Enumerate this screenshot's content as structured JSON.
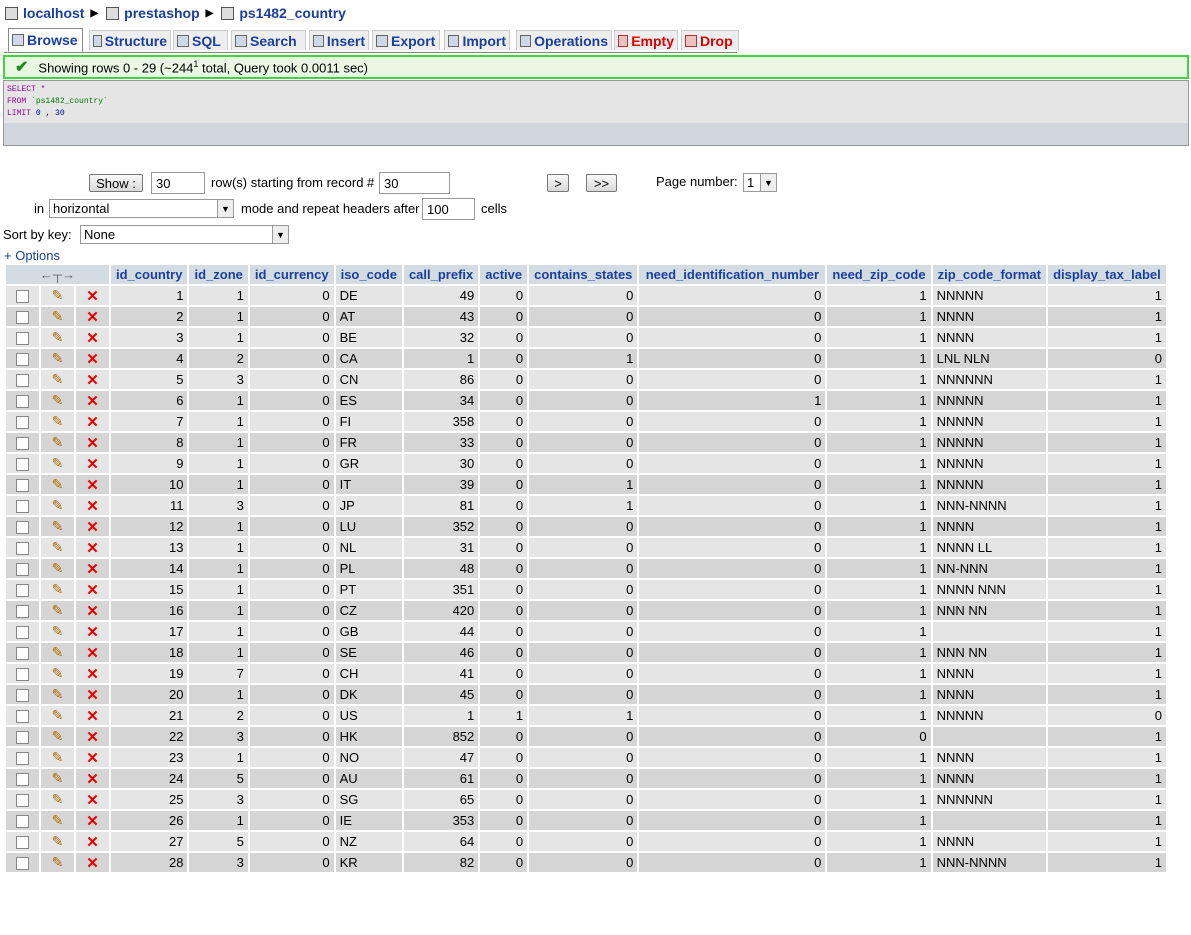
{
  "breadcrumb": {
    "server": "localhost",
    "database": "prestashop",
    "table": "ps1482_country"
  },
  "tabs": [
    {
      "label": "Browse",
      "icon": "browse-icon",
      "active": true,
      "red": false
    },
    {
      "label": "Structure",
      "icon": "structure-icon",
      "active": false,
      "red": false
    },
    {
      "label": "SQL",
      "icon": "sql-icon",
      "active": false,
      "red": false
    },
    {
      "label": "Search",
      "icon": "search-icon",
      "active": false,
      "red": false
    },
    {
      "label": "Insert",
      "icon": "insert-icon",
      "active": false,
      "red": false
    },
    {
      "label": "Export",
      "icon": "export-icon",
      "active": false,
      "red": false
    },
    {
      "label": "Import",
      "icon": "import-icon",
      "active": false,
      "red": false
    },
    {
      "label": "Operations",
      "icon": "operations-icon",
      "active": false,
      "red": false
    },
    {
      "label": "Empty",
      "icon": "empty-icon",
      "active": false,
      "red": true
    },
    {
      "label": "Drop",
      "icon": "drop-icon",
      "active": false,
      "red": true
    }
  ],
  "notice": {
    "text_before": "Showing rows 0 - 29 (~244",
    "superscript": "1",
    "text_after": " total, Query took 0.0011 sec)"
  },
  "sql": {
    "line1_kw": "SELECT",
    "line1_rest": " *",
    "line2_kw": "FROM",
    "line2_table": "`ps1482_country`",
    "line3_kw": "LIMIT",
    "line3_start": "0",
    "line3_sep": " , ",
    "line3_count": "30"
  },
  "navigation": {
    "show_label": "Show :",
    "rows_value": "30",
    "rows_text": "row(s) starting from record #",
    "start_value": "30",
    "next_label": ">",
    "last_label": ">>",
    "page_label": "Page number:",
    "page_value": "1",
    "in_label": "in",
    "mode_value": "horizontal",
    "repeat_text": "mode and repeat headers after",
    "repeat_value": "100",
    "cells_text": "cells"
  },
  "sort": {
    "label": "Sort by key:",
    "value": "None"
  },
  "options_link": "+ Options",
  "columns": [
    "id_country",
    "id_zone",
    "id_currency",
    "iso_code",
    "call_prefix",
    "active",
    "contains_states",
    "need_identification_number",
    "need_zip_code",
    "zip_code_format",
    "display_tax_label"
  ],
  "rows": [
    [
      "1",
      "1",
      "0",
      "DE",
      "49",
      "0",
      "0",
      "0",
      "1",
      "NNNNN",
      "1"
    ],
    [
      "2",
      "1",
      "0",
      "AT",
      "43",
      "0",
      "0",
      "0",
      "1",
      "NNNN",
      "1"
    ],
    [
      "3",
      "1",
      "0",
      "BE",
      "32",
      "0",
      "0",
      "0",
      "1",
      "NNNN",
      "1"
    ],
    [
      "4",
      "2",
      "0",
      "CA",
      "1",
      "0",
      "1",
      "0",
      "1",
      "LNL NLN",
      "0"
    ],
    [
      "5",
      "3",
      "0",
      "CN",
      "86",
      "0",
      "0",
      "0",
      "1",
      "NNNNNN",
      "1"
    ],
    [
      "6",
      "1",
      "0",
      "ES",
      "34",
      "0",
      "0",
      "1",
      "1",
      "NNNNN",
      "1"
    ],
    [
      "7",
      "1",
      "0",
      "FI",
      "358",
      "0",
      "0",
      "0",
      "1",
      "NNNNN",
      "1"
    ],
    [
      "8",
      "1",
      "0",
      "FR",
      "33",
      "0",
      "0",
      "0",
      "1",
      "NNNNN",
      "1"
    ],
    [
      "9",
      "1",
      "0",
      "GR",
      "30",
      "0",
      "0",
      "0",
      "1",
      "NNNNN",
      "1"
    ],
    [
      "10",
      "1",
      "0",
      "IT",
      "39",
      "0",
      "1",
      "0",
      "1",
      "NNNNN",
      "1"
    ],
    [
      "11",
      "3",
      "0",
      "JP",
      "81",
      "0",
      "1",
      "0",
      "1",
      "NNN-NNNN",
      "1"
    ],
    [
      "12",
      "1",
      "0",
      "LU",
      "352",
      "0",
      "0",
      "0",
      "1",
      "NNNN",
      "1"
    ],
    [
      "13",
      "1",
      "0",
      "NL",
      "31",
      "0",
      "0",
      "0",
      "1",
      "NNNN LL",
      "1"
    ],
    [
      "14",
      "1",
      "0",
      "PL",
      "48",
      "0",
      "0",
      "0",
      "1",
      "NN-NNN",
      "1"
    ],
    [
      "15",
      "1",
      "0",
      "PT",
      "351",
      "0",
      "0",
      "0",
      "1",
      "NNNN NNN",
      "1"
    ],
    [
      "16",
      "1",
      "0",
      "CZ",
      "420",
      "0",
      "0",
      "0",
      "1",
      "NNN NN",
      "1"
    ],
    [
      "17",
      "1",
      "0",
      "GB",
      "44",
      "0",
      "0",
      "0",
      "1",
      "",
      "1"
    ],
    [
      "18",
      "1",
      "0",
      "SE",
      "46",
      "0",
      "0",
      "0",
      "1",
      "NNN NN",
      "1"
    ],
    [
      "19",
      "7",
      "0",
      "CH",
      "41",
      "0",
      "0",
      "0",
      "1",
      "NNNN",
      "1"
    ],
    [
      "20",
      "1",
      "0",
      "DK",
      "45",
      "0",
      "0",
      "0",
      "1",
      "NNNN",
      "1"
    ],
    [
      "21",
      "2",
      "0",
      "US",
      "1",
      "1",
      "1",
      "0",
      "1",
      "NNNNN",
      "0"
    ],
    [
      "22",
      "3",
      "0",
      "HK",
      "852",
      "0",
      "0",
      "0",
      "0",
      "",
      "1"
    ],
    [
      "23",
      "1",
      "0",
      "NO",
      "47",
      "0",
      "0",
      "0",
      "1",
      "NNNN",
      "1"
    ],
    [
      "24",
      "5",
      "0",
      "AU",
      "61",
      "0",
      "0",
      "0",
      "1",
      "NNNN",
      "1"
    ],
    [
      "25",
      "3",
      "0",
      "SG",
      "65",
      "0",
      "0",
      "0",
      "1",
      "NNNNNN",
      "1"
    ],
    [
      "26",
      "1",
      "0",
      "IE",
      "353",
      "0",
      "0",
      "0",
      "1",
      "",
      "1"
    ],
    [
      "27",
      "5",
      "0",
      "NZ",
      "64",
      "0",
      "0",
      "0",
      "1",
      "NNNN",
      "1"
    ],
    [
      "28",
      "3",
      "0",
      "KR",
      "82",
      "0",
      "0",
      "0",
      "1",
      "NNN-NNNN",
      "1"
    ]
  ],
  "colors": {
    "header_bg": "#d3dce3",
    "row_odd": "#e5e5e5",
    "row_even": "#d5d5d5",
    "link": "#1a3fa0",
    "notice_border": "#3ed63e"
  }
}
